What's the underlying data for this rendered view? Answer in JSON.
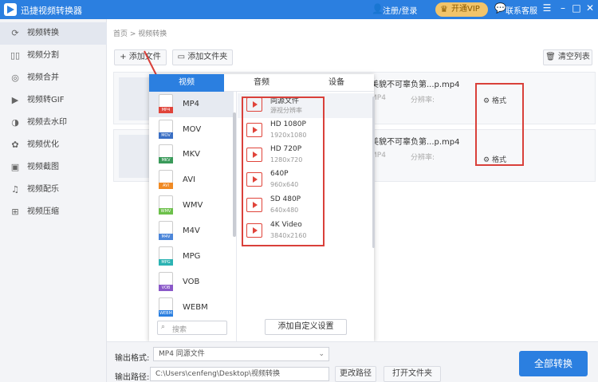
{
  "app": {
    "title": "迅捷视频转换器"
  },
  "titlebar": {
    "login": "注册/登录",
    "vip": "开通VIP",
    "support": "联系客服",
    "controls": [
      "☰",
      "–",
      "□",
      "✕"
    ]
  },
  "sidebar": {
    "items": [
      {
        "label": "视频转换",
        "icon": "convert-icon",
        "glyph": "⟳",
        "active": true
      },
      {
        "label": "视频分割",
        "icon": "split-icon",
        "glyph": "▯▯"
      },
      {
        "label": "视频合并",
        "icon": "merge-icon",
        "glyph": "◎"
      },
      {
        "label": "视频转GIF",
        "icon": "gif-icon",
        "glyph": "▶"
      },
      {
        "label": "视频去水印",
        "icon": "watermark-icon",
        "glyph": "◑"
      },
      {
        "label": "视频优化",
        "icon": "optimize-icon",
        "glyph": "✿"
      },
      {
        "label": "视频截图",
        "icon": "screenshot-icon",
        "glyph": "▣"
      },
      {
        "label": "视频配乐",
        "icon": "music-icon",
        "glyph": "♫"
      },
      {
        "label": "视频压缩",
        "icon": "compress-icon",
        "glyph": "⊞"
      }
    ]
  },
  "breadcrumb": {
    "text": "首页 > 视频转换"
  },
  "toolbar": {
    "add_file": "+ 添加文件",
    "add_folder": "▭ 添加文件夹",
    "clear": "🗑 清空列表"
  },
  "files": [
    {
      "name": "美貌不可辜负第...p.mp4",
      "format": "MP4",
      "resolution": "分辨率:",
      "settings": "格式"
    },
    {
      "name": "美貌不可辜负第...p.mp4",
      "format": "MP4",
      "resolution": "分辨率:",
      "settings": "格式"
    }
  ],
  "popup": {
    "tabs": [
      "视频",
      "音频",
      "设备"
    ],
    "formats": [
      {
        "name": "MP4",
        "color": "#e0443a",
        "active": true
      },
      {
        "name": "MOV",
        "color": "#3a6fc4"
      },
      {
        "name": "MKV",
        "color": "#3a9a5a"
      },
      {
        "name": "AVI",
        "color": "#f08a24"
      },
      {
        "name": "WMV",
        "color": "#6cc04a"
      },
      {
        "name": "M4V",
        "color": "#4c86d9"
      },
      {
        "name": "MPG",
        "color": "#2cb3b3"
      },
      {
        "name": "VOB",
        "color": "#8a58c8"
      },
      {
        "name": "WEBM",
        "color": "#2b7fe0"
      }
    ],
    "search_placeholder": "搜索",
    "qualities": [
      {
        "title": "同源文件",
        "sub": "源视分辨率",
        "active": true
      },
      {
        "title": "HD 1080P",
        "sub": "1920x1080"
      },
      {
        "title": "HD 720P",
        "sub": "1280x720"
      },
      {
        "title": "640P",
        "sub": "960x640"
      },
      {
        "title": "SD 480P",
        "sub": "640x480"
      },
      {
        "title": "4K Video",
        "sub": "3840x2160"
      }
    ],
    "custom_button": "添加自定义设置"
  },
  "bottom": {
    "output_format_label": "输出格式:",
    "output_format_value": "MP4  同源文件",
    "output_path_label": "输出路径:",
    "output_path_value": "C:\\Users\\cenfeng\\Desktop\\视频转换",
    "change_path": "更改路径",
    "open_folder": "打开文件夹",
    "convert_all": "全部转换"
  },
  "colors": {
    "accent": "#2b7fe0",
    "highlight": "#d9403a"
  }
}
